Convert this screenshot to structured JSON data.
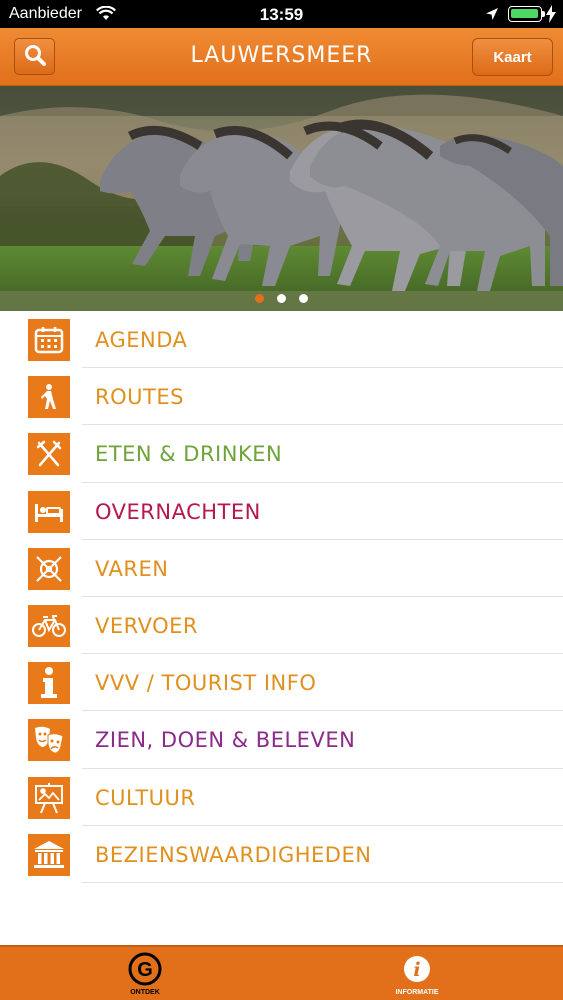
{
  "status_bar": {
    "carrier": "Aanbieder",
    "time": "13:59",
    "battery_level": 1.0
  },
  "header": {
    "title": "LAUWERSMEER",
    "map_button": "Kaart",
    "search_icon": "search-icon"
  },
  "hero": {
    "image": "horses-photo",
    "page_count": 3,
    "active_page": 1
  },
  "menu": {
    "items": [
      {
        "label": "AGENDA",
        "icon": "calendar-icon",
        "color": "#e0901e"
      },
      {
        "label": "ROUTES",
        "icon": "hiker-icon",
        "color": "#e0901e"
      },
      {
        "label": "ETEN & DRINKEN",
        "icon": "cutlery-icon",
        "color": "#6ea33a"
      },
      {
        "label": "OVERNACHTEN",
        "icon": "bed-icon",
        "color": "#b5174f"
      },
      {
        "label": "VAREN",
        "icon": "compass-icon",
        "color": "#e0901e"
      },
      {
        "label": "VERVOER",
        "icon": "bicycle-icon",
        "color": "#e0901e"
      },
      {
        "label": "VVV / TOURIST INFO",
        "icon": "info-icon",
        "color": "#e0901e"
      },
      {
        "label": "ZIEN, DOEN & BELEVEN",
        "icon": "theater-masks-icon",
        "color": "#8a2a8a"
      },
      {
        "label": "CULTUUR",
        "icon": "easel-icon",
        "color": "#e0901e"
      },
      {
        "label": "BEZIENSWAARDIGHEDEN",
        "icon": "museum-icon",
        "color": "#e0901e"
      }
    ]
  },
  "tab_bar": {
    "tabs": [
      {
        "label": "ONTDEK",
        "icon": "g-logo-icon"
      },
      {
        "label": "INFORMATIE",
        "icon": "info-circle-icon"
      }
    ]
  },
  "colors": {
    "brand_orange": "#e2701b"
  }
}
